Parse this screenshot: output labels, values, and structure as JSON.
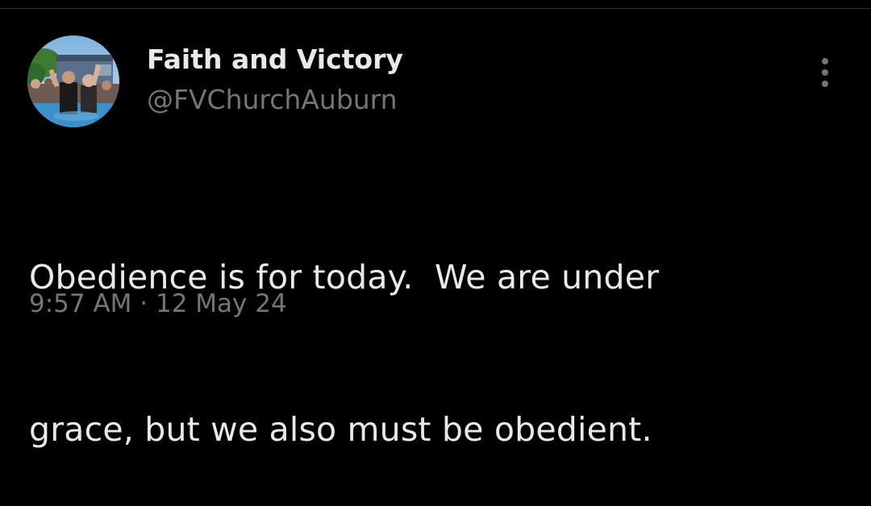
{
  "tweet": {
    "author": {
      "display_name": "Faith and Victory",
      "handle": "@FVChurchAuburn",
      "avatar_icon": "profile-photo"
    },
    "text_lines": [
      "Obedience is for today.  We are under",
      "grace, but we also must be obedient."
    ],
    "timestamp": "9:57 AM · 12 May 24",
    "menu_icon": "more-options-icon"
  },
  "colors": {
    "background": "#000000",
    "primary_text": "#e7e9ea",
    "secondary_text": "#71767b"
  }
}
